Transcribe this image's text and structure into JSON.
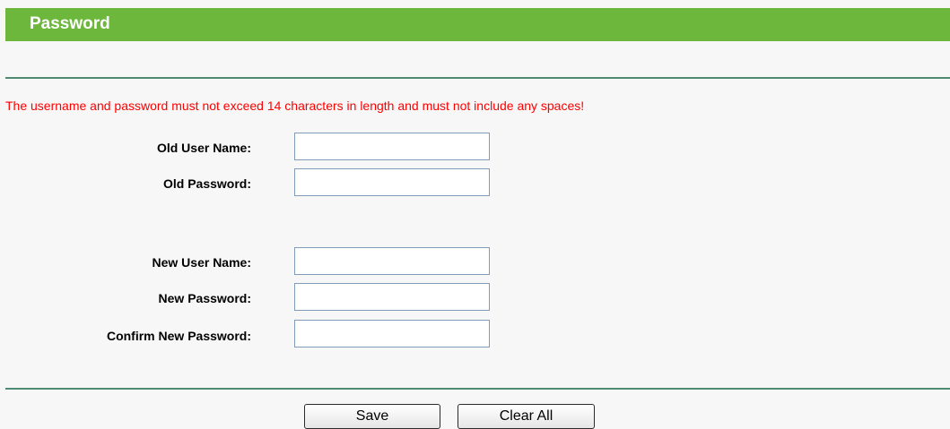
{
  "header": {
    "title": "Password",
    "color": "#6cb73c"
  },
  "notice": {
    "text": "The username and password must not exceed 14 characters in length and must not include any spaces!",
    "color": "#ff0000"
  },
  "form": {
    "old_user_name": {
      "label": "Old User Name:",
      "value": ""
    },
    "old_password": {
      "label": "Old Password:",
      "value": ""
    },
    "new_user_name": {
      "label": "New User Name:",
      "value": ""
    },
    "new_password": {
      "label": "New Password:",
      "value": ""
    },
    "confirm_new_password": {
      "label": "Confirm New Password:",
      "value": ""
    }
  },
  "buttons": {
    "save": "Save",
    "clear_all": "Clear All"
  }
}
